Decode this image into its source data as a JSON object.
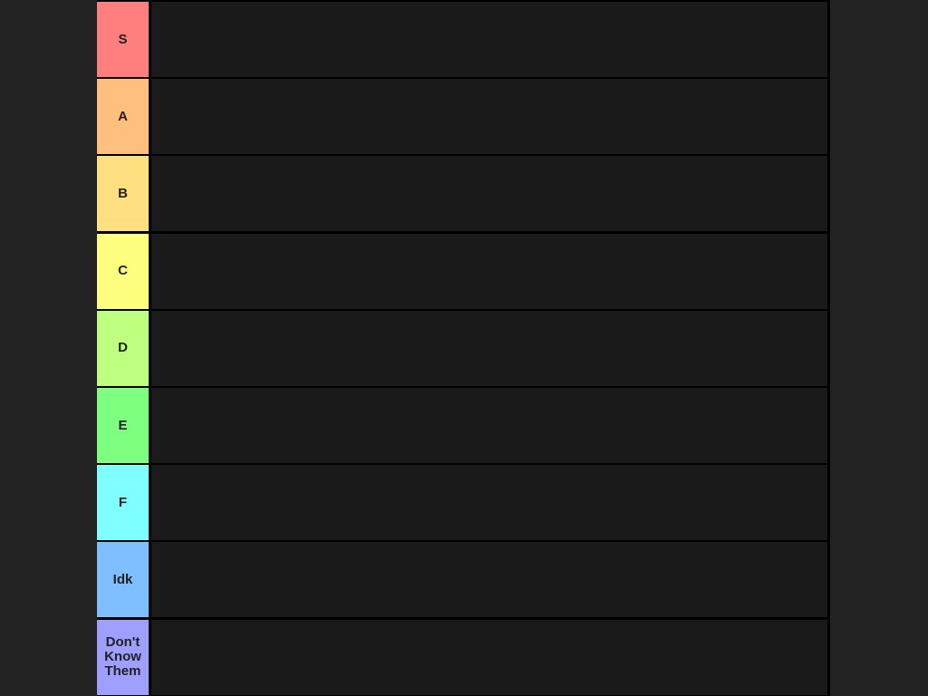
{
  "tiers": [
    {
      "label": "S",
      "color": "#ff7f7f"
    },
    {
      "label": "A",
      "color": "#ffbf7f"
    },
    {
      "label": "B",
      "color": "#ffdf7f"
    },
    {
      "label": "C",
      "color": "#ffff7f"
    },
    {
      "label": "D",
      "color": "#bfff7f"
    },
    {
      "label": "E",
      "color": "#7fff7f"
    },
    {
      "label": "F",
      "color": "#7fffff"
    },
    {
      "label": "Idk",
      "color": "#7fbfff"
    },
    {
      "label": "Don't Know Them",
      "color": "#9f9fff"
    }
  ]
}
